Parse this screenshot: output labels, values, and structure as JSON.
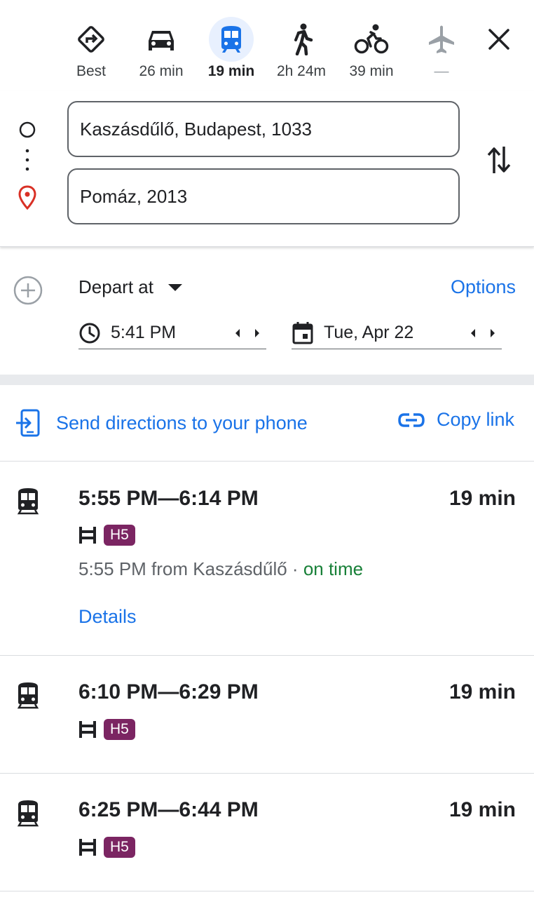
{
  "modes": [
    {
      "id": "best",
      "label": "Best",
      "icon": "directions-icon",
      "active": false
    },
    {
      "id": "drive",
      "label": "26 min",
      "icon": "car-icon",
      "active": false
    },
    {
      "id": "transit",
      "label": "19 min",
      "icon": "train-icon",
      "active": true
    },
    {
      "id": "walk",
      "label": "2h 24m",
      "icon": "walk-icon",
      "active": false
    },
    {
      "id": "bike",
      "label": "39 min",
      "icon": "bike-icon",
      "active": false
    },
    {
      "id": "flight",
      "label": "—",
      "icon": "plane-icon",
      "active": false
    }
  ],
  "waypoints": {
    "origin": "Kaszásdűlő, Budapest, 1033",
    "destination": "Pomáz, 2013"
  },
  "depart": {
    "mode_label": "Depart at",
    "options_label": "Options",
    "time": "5:41 PM",
    "date": "Tue, Apr 22"
  },
  "share": {
    "send_label": "Send directions to your phone",
    "copy_label": "Copy link"
  },
  "trips": [
    {
      "times": "5:55 PM—6:14 PM",
      "duration": "19 min",
      "line": "H5",
      "departure_info": "5:55 PM from Kaszásdűlő",
      "status": "on time",
      "separator": " · ",
      "details_label": "Details"
    },
    {
      "times": "6:10 PM—6:29 PM",
      "duration": "19 min",
      "line": "H5"
    },
    {
      "times": "6:25 PM—6:44 PM",
      "duration": "19 min",
      "line": "H5"
    }
  ],
  "colors": {
    "accent": "#1a73e8",
    "active_bg": "#e8f0fe",
    "destination_pin": "#d93025",
    "line_badge": "#7b2562",
    "on_time": "#188038"
  }
}
